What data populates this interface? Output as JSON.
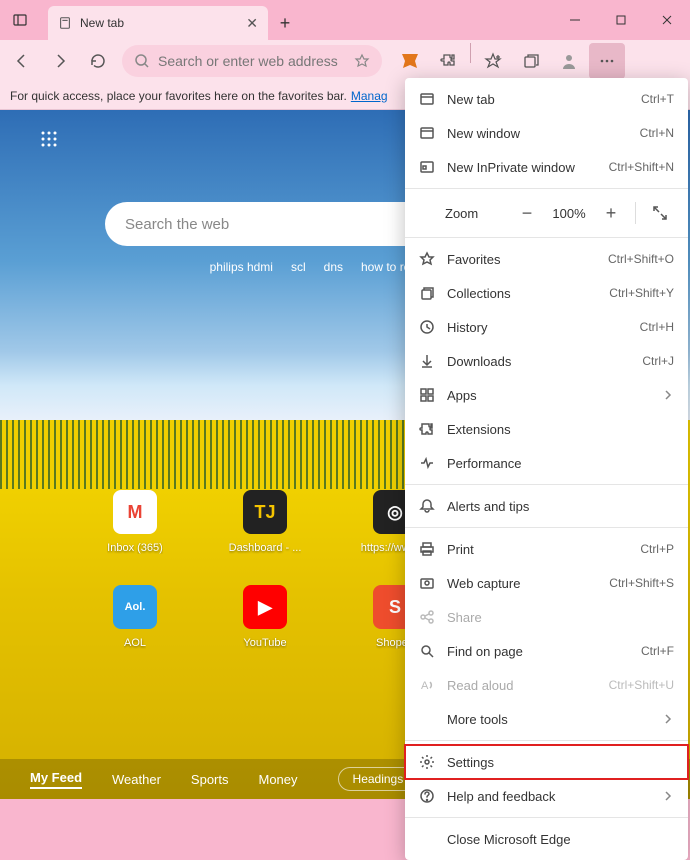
{
  "window": {
    "tab_title": "New tab",
    "tab_icon": "page"
  },
  "toolbar": {
    "address_placeholder": "Search or enter web address"
  },
  "favbar": {
    "text": "For quick access, place your favorites here on the favorites bar.",
    "link": "Manag"
  },
  "newtab": {
    "search_placeholder": "Search the web",
    "quick_links": [
      "philips hdmi",
      "scl",
      "dns",
      "how to reinstall bluet..."
    ],
    "tiles_row1": [
      {
        "label": "Inbox (365)",
        "icon_text": "M",
        "bg": "#fff",
        "fg": "#ea4335"
      },
      {
        "label": "Dashboard - ...",
        "icon_text": "TJ",
        "bg": "#222",
        "fg": "#f5c400"
      },
      {
        "label": "https://www....",
        "icon_text": "◎",
        "bg": "#222",
        "fg": "#fff"
      }
    ],
    "tiles_row2": [
      {
        "label": "AOL",
        "icon_text": "Aol.",
        "bg": "#2e9fe8",
        "fg": "#fff"
      },
      {
        "label": "YouTube",
        "icon_text": "▶",
        "bg": "#ff0000",
        "fg": "#fff"
      },
      {
        "label": "Shopee",
        "icon_text": "S",
        "bg": "#ee4d2d",
        "fg": "#fff"
      }
    ],
    "bottom_nav": [
      "My Feed",
      "Weather",
      "Sports",
      "Money"
    ],
    "headings_label": "Headings"
  },
  "menu": {
    "items": [
      {
        "icon": "newtab",
        "label": "New tab",
        "shortcut": "Ctrl+T"
      },
      {
        "icon": "window",
        "label": "New window",
        "shortcut": "Ctrl+N"
      },
      {
        "icon": "inprivate",
        "label": "New InPrivate window",
        "shortcut": "Ctrl+Shift+N"
      },
      {
        "sep": true
      },
      {
        "zoom": true,
        "label": "Zoom",
        "value": "100%"
      },
      {
        "sep": true
      },
      {
        "icon": "star",
        "label": "Favorites",
        "shortcut": "Ctrl+Shift+O"
      },
      {
        "icon": "collections",
        "label": "Collections",
        "shortcut": "Ctrl+Shift+Y"
      },
      {
        "icon": "history",
        "label": "History",
        "shortcut": "Ctrl+H"
      },
      {
        "icon": "download",
        "label": "Downloads",
        "shortcut": "Ctrl+J"
      },
      {
        "icon": "apps",
        "label": "Apps",
        "chevron": true
      },
      {
        "icon": "puzzle",
        "label": "Extensions"
      },
      {
        "icon": "heartbeat",
        "label": "Performance"
      },
      {
        "sep": true
      },
      {
        "icon": "bell",
        "label": "Alerts and tips"
      },
      {
        "sep": true
      },
      {
        "icon": "print",
        "label": "Print",
        "shortcut": "Ctrl+P"
      },
      {
        "icon": "capture",
        "label": "Web capture",
        "shortcut": "Ctrl+Shift+S"
      },
      {
        "icon": "share",
        "label": "Share",
        "disabled": true
      },
      {
        "icon": "find",
        "label": "Find on page",
        "shortcut": "Ctrl+F"
      },
      {
        "icon": "readaloud",
        "label": "Read aloud",
        "shortcut": "Ctrl+Shift+U",
        "disabled": true
      },
      {
        "label": "More tools",
        "chevron": true,
        "indent": true
      },
      {
        "sep": true
      },
      {
        "icon": "gear",
        "label": "Settings",
        "highlighted": true
      },
      {
        "icon": "help",
        "label": "Help and feedback",
        "chevron": true
      },
      {
        "sep": true
      },
      {
        "label": "Close Microsoft Edge",
        "indent": true
      }
    ]
  }
}
